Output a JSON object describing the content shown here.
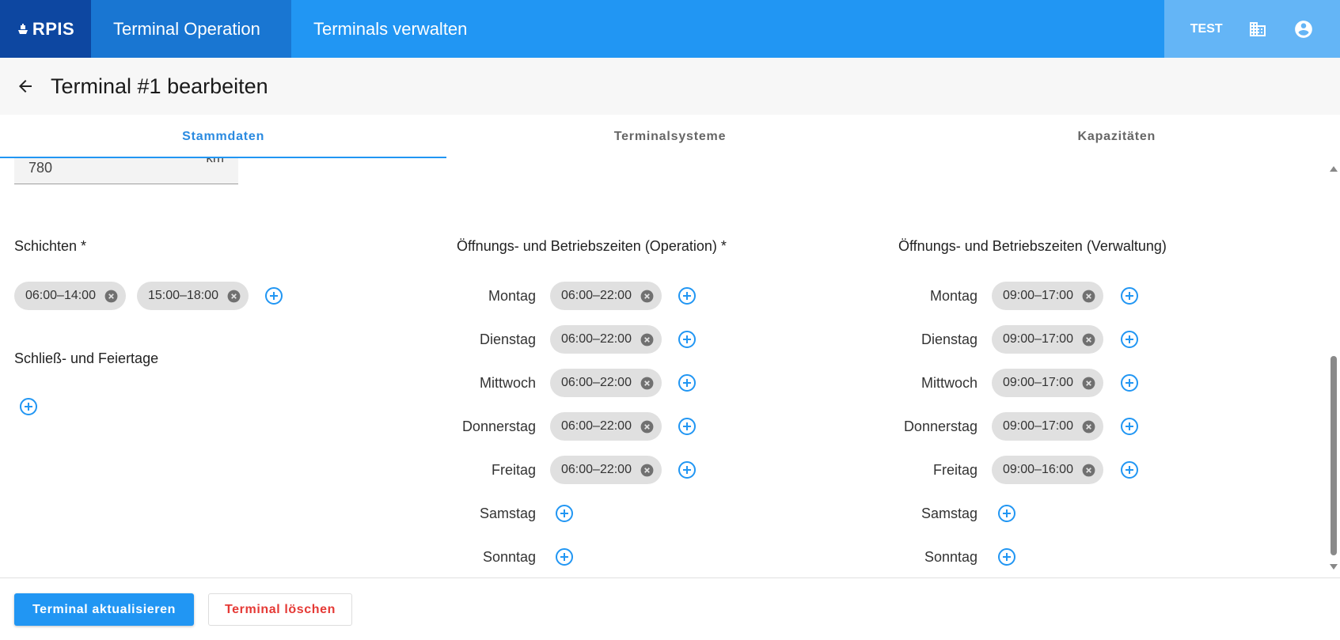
{
  "app": {
    "brand": "RPIS",
    "nav_tabs": [
      {
        "label": "Terminal Operation",
        "active": true
      },
      {
        "label": "Terminals verwalten",
        "active": false
      }
    ],
    "environment": "TEST"
  },
  "page": {
    "title": "Terminal #1 bearbeiten"
  },
  "tabs": [
    {
      "label": "Stammdaten",
      "active": true
    },
    {
      "label": "Terminalsysteme",
      "active": false
    },
    {
      "label": "Kapazitäten",
      "active": false
    }
  ],
  "distance_field": {
    "value": "780",
    "unit": "km"
  },
  "shifts": {
    "label": "Schichten *",
    "chips": [
      "06:00–14:00",
      "15:00–18:00"
    ]
  },
  "closures": {
    "label": "Schließ- und Feiertage"
  },
  "operation_hours": {
    "label": "Öffnungs- und Betriebszeiten (Operation) *",
    "days": [
      {
        "day": "Montag",
        "chips": [
          "06:00–22:00"
        ]
      },
      {
        "day": "Dienstag",
        "chips": [
          "06:00–22:00"
        ]
      },
      {
        "day": "Mittwoch",
        "chips": [
          "06:00–22:00"
        ]
      },
      {
        "day": "Donnerstag",
        "chips": [
          "06:00–22:00"
        ]
      },
      {
        "day": "Freitag",
        "chips": [
          "06:00–22:00"
        ]
      },
      {
        "day": "Samstag",
        "chips": []
      },
      {
        "day": "Sonntag",
        "chips": []
      }
    ]
  },
  "admin_hours": {
    "label": "Öffnungs- und Betriebszeiten (Verwaltung)",
    "days": [
      {
        "day": "Montag",
        "chips": [
          "09:00–17:00"
        ]
      },
      {
        "day": "Dienstag",
        "chips": [
          "09:00–17:00"
        ]
      },
      {
        "day": "Mittwoch",
        "chips": [
          "09:00–17:00"
        ]
      },
      {
        "day": "Donnerstag",
        "chips": [
          "09:00–17:00"
        ]
      },
      {
        "day": "Freitag",
        "chips": [
          "09:00–16:00"
        ]
      },
      {
        "day": "Samstag",
        "chips": []
      },
      {
        "day": "Sonntag",
        "chips": []
      }
    ]
  },
  "footer": {
    "update_label": "Terminal aktualisieren",
    "delete_label": "Terminal löschen"
  },
  "icons": {
    "logo": "ship-icon",
    "organization": "building-icon",
    "account": "account-circle-icon",
    "back": "arrow-left-icon",
    "add": "add-circle-icon",
    "remove": "cancel-icon"
  },
  "colors": {
    "primary": "#2196f3",
    "brand_dark": "#0d47a1",
    "nav_active": "#1976d2",
    "nav_right": "#64b5f6",
    "danger": "#e53935",
    "chip": "#e0e0e0"
  }
}
